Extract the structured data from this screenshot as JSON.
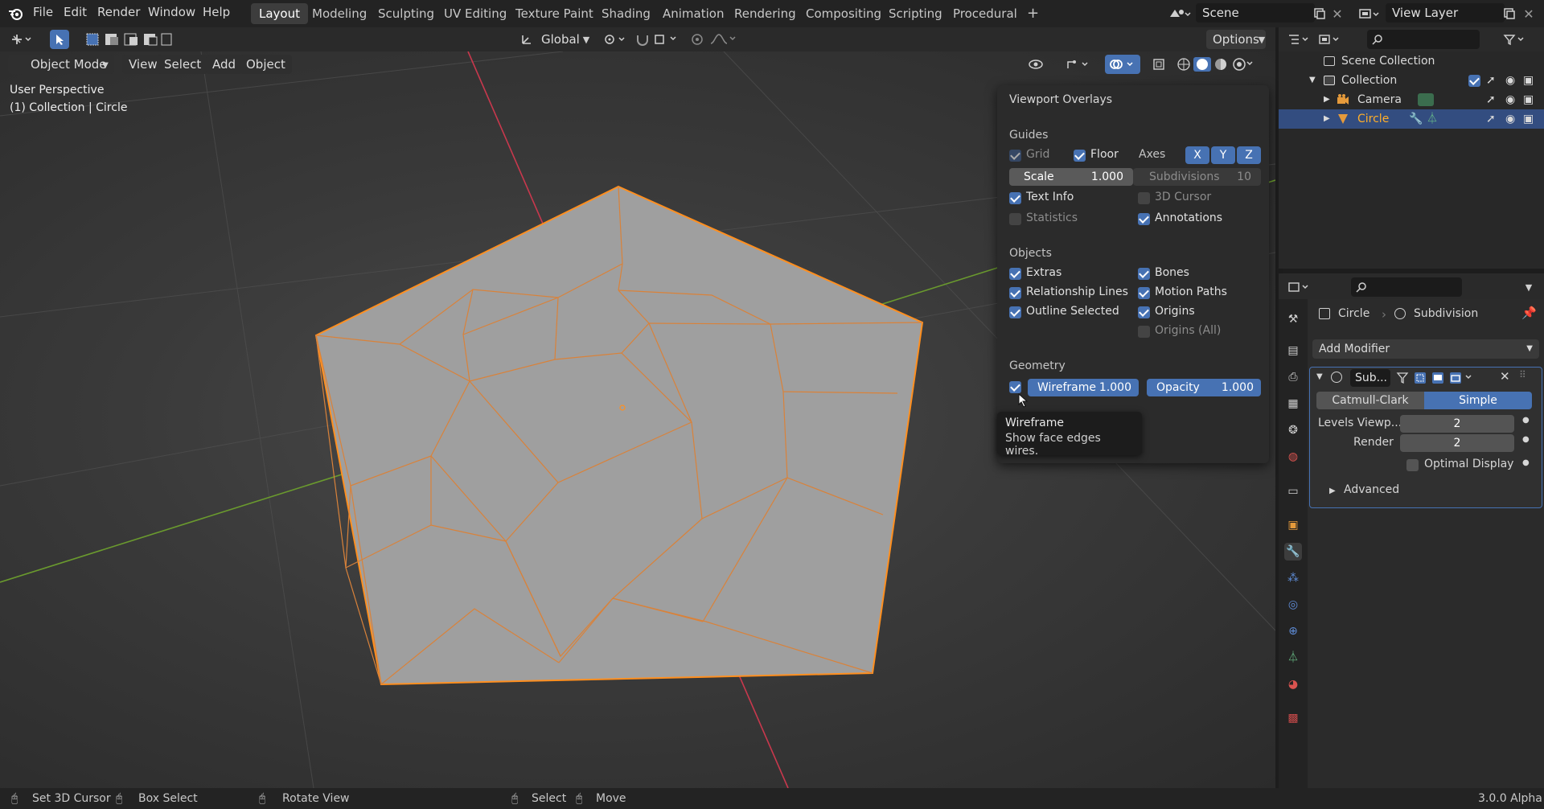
{
  "app_menu": [
    "File",
    "Edit",
    "Render",
    "Window",
    "Help"
  ],
  "workspaces": [
    "Layout",
    "Modeling",
    "Sculpting",
    "UV Editing",
    "Texture Paint",
    "Shading",
    "Animation",
    "Rendering",
    "Compositing",
    "Scripting",
    "Procedural"
  ],
  "active_workspace": "Layout",
  "add_workspace": "+",
  "scene": {
    "label": "Scene",
    "icon": "scene-icon"
  },
  "view_layer": {
    "label": "View Layer",
    "icon": "view-layer-icon"
  },
  "tool_header": {
    "orientation": "Global",
    "options": "Options"
  },
  "viewport_header": {
    "mode": "Object Mode",
    "menus": [
      "View",
      "Select",
      "Add",
      "Object"
    ]
  },
  "viewport_info": {
    "perspective": "User Perspective",
    "object": "(1) Collection | Circle"
  },
  "overlays": {
    "title": "Viewport Overlays",
    "guides_heading": "Guides",
    "grid": "Grid",
    "floor": "Floor",
    "axes": "Axes",
    "axis_x": "X",
    "axis_y": "Y",
    "axis_z": "Z",
    "scale_label": "Scale",
    "scale_value": "1.000",
    "subdivisions_label": "Subdivisions",
    "subdivisions_value": "10",
    "text_info": "Text Info",
    "cursor_3d": "3D Cursor",
    "statistics": "Statistics",
    "annotations": "Annotations",
    "objects_heading": "Objects",
    "extras": "Extras",
    "bones": "Bones",
    "relationship_lines": "Relationship Lines",
    "motion_paths": "Motion Paths",
    "outline_selected": "Outline Selected",
    "origins": "Origins",
    "origins_all": "Origins (All)",
    "geometry_heading": "Geometry",
    "wireframe_label": "Wireframe",
    "wireframe_value": "1.000",
    "opacity_label": "Opacity",
    "opacity_value": "1.000"
  },
  "tooltip": {
    "title": "Wireframe",
    "body": "Show face edges wires."
  },
  "outliner": {
    "root": "Scene Collection",
    "collection": "Collection",
    "items": [
      "Camera",
      "Circle"
    ]
  },
  "properties": {
    "breadcrumb_object": "Circle",
    "breadcrumb_modifier": "Subdivision",
    "add_modifier": "Add Modifier",
    "modifier_name": "Sub...",
    "catmull_clark": "Catmull-Clark",
    "simple": "Simple",
    "levels_viewport_label": "Levels Viewp...",
    "levels_viewport_value": "2",
    "render_label": "Render",
    "render_value": "2",
    "optimal_display": "Optimal Display",
    "advanced": "Advanced"
  },
  "status_bar": {
    "set_cursor": "Set 3D Cursor",
    "box_select": "Box Select",
    "rotate_view": "Rotate View",
    "select": "Select",
    "move": "Move",
    "version": "3.0.0 Alpha"
  },
  "colors": {
    "accent": "#4772b3",
    "selection_outline": "#ff8f1f",
    "mesh_face": "#9f9f9f",
    "x_axis": "#c8384d",
    "y_axis": "#6a9a2e"
  }
}
